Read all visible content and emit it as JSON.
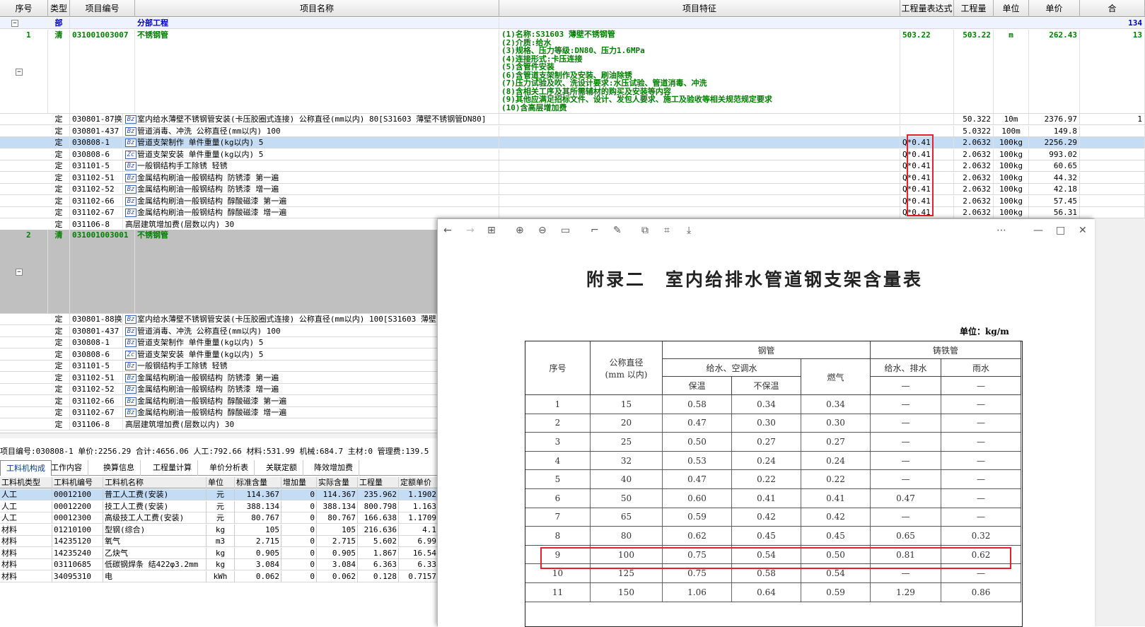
{
  "header": {
    "seq": "序号",
    "type": "类型",
    "code": "项目编号",
    "name": "项目名称",
    "feature": "项目特征",
    "expr": "工程量表达式",
    "qty": "工程量",
    "unit": "单位",
    "price": "单价",
    "total": "合"
  },
  "part_row": {
    "type": "部",
    "name": "分部工程",
    "total": "134"
  },
  "item1": {
    "seq": "1",
    "type": "清",
    "code": "031001003007",
    "name": "不锈钢管",
    "expr": "503.22",
    "qty": "503.22",
    "unit": "m",
    "price": "262.43",
    "total": "13",
    "features": [
      "(1)名称:S31603 薄壁不锈钢管",
      "(2)介质:给水",
      "(3)规格、压力等级:DN80、压力1.6MPa",
      "(4)连接形式:卡压连接",
      "(5)含管件安装",
      "(6)含管道支架制作及安装、刷油除锈",
      "(7)压力试验及吹、洗设计要求:水压试验、管道消毒、冲洗",
      "(8)含相关工序及其所需辅材的购买及安装等内容",
      "(9)其他应满足招标文件、设计、发包人要求、施工及验收等相关规范规定要求",
      "(10)含高层增加费"
    ]
  },
  "sub1": [
    {
      "type": "定",
      "code": "030801-87换",
      "tag": "Bz",
      "name": "室内给水薄壁不锈钢管安装(卡压胶圈式连接) 公称直径(mm以内) 80[S31603 薄壁不锈钢管DN80]",
      "expr": "",
      "qty": "50.322",
      "unit": "10m",
      "price": "2376.97",
      "total": "1"
    },
    {
      "type": "定",
      "code": "030801-437",
      "tag": "Bz",
      "name": "管道消毒、冲洗 公称直径(mm以内) 100",
      "expr": "",
      "qty": "5.0322",
      "unit": "100m",
      "price": "149.8",
      "total": ""
    },
    {
      "type": "定",
      "code": "030808-1",
      "tag": "Bz",
      "name": "管道支架制作 单件重量(kg以内) 5",
      "expr": "Q*0.41",
      "qty": "2.0632",
      "unit": "100kg",
      "price": "2256.29",
      "total": ""
    },
    {
      "type": "定",
      "code": "030808-6",
      "tag": "Zc",
      "name": "管道支架安装 单件重量(kg以内) 5",
      "expr": "Q*0.41",
      "qty": "2.0632",
      "unit": "100kg",
      "price": "993.02",
      "total": ""
    },
    {
      "type": "定",
      "code": "031101-5",
      "tag": "Bz",
      "name": "一般钢结构手工除锈 轻锈",
      "expr": "Q*0.41",
      "qty": "2.0632",
      "unit": "100kg",
      "price": "60.65",
      "total": ""
    },
    {
      "type": "定",
      "code": "031102-51",
      "tag": "Bz",
      "name": "金属结构刷油一般钢结构 防锈漆 第一遍",
      "expr": "Q*0.41",
      "qty": "2.0632",
      "unit": "100kg",
      "price": "44.32",
      "total": ""
    },
    {
      "type": "定",
      "code": "031102-52",
      "tag": "Bz",
      "name": "金属结构刷油一般钢结构 防锈漆 增一遍",
      "expr": "Q*0.41",
      "qty": "2.0632",
      "unit": "100kg",
      "price": "42.18",
      "total": ""
    },
    {
      "type": "定",
      "code": "031102-66",
      "tag": "Bz",
      "name": "金属结构刷油一般钢结构 醇酸磁漆 第一遍",
      "expr": "Q*0.41",
      "qty": "2.0632",
      "unit": "100kg",
      "price": "57.45",
      "total": ""
    },
    {
      "type": "定",
      "code": "031102-67",
      "tag": "Bz",
      "name": "金属结构刷油一般钢结构 醇酸磁漆 增一遍",
      "expr": "Q*0.41",
      "qty": "2.0632",
      "unit": "100kg",
      "price": "56.31",
      "total": ""
    },
    {
      "type": "定",
      "code": "031106-8",
      "tag": "",
      "name": "高层建筑增加费(层数以内) 30",
      "expr": "",
      "qty": "",
      "unit": "",
      "price": "",
      "total": ""
    }
  ],
  "item2": {
    "seq": "2",
    "type": "清",
    "code": "031001003001",
    "name": "不锈钢管"
  },
  "sub2": [
    {
      "type": "定",
      "code": "030801-88换",
      "tag": "Bz",
      "name": "室内给水薄壁不锈钢管安装(卡压胶圈式连接) 公称直径(mm以内) 100[S31603 薄壁"
    },
    {
      "type": "定",
      "code": "030801-437",
      "tag": "Bz",
      "name": "管道消毒、冲洗 公称直径(mm以内) 100"
    },
    {
      "type": "定",
      "code": "030808-1",
      "tag": "Bz",
      "name": "管道支架制作 单件重量(kg以内) 5"
    },
    {
      "type": "定",
      "code": "030808-6",
      "tag": "Zc",
      "name": "管道支架安装 单件重量(kg以内) 5"
    },
    {
      "type": "定",
      "code": "031101-5",
      "tag": "Bz",
      "name": "一般钢结构手工除锈 轻锈"
    },
    {
      "type": "定",
      "code": "031102-51",
      "tag": "Bz",
      "name": "金属结构刷油一般钢结构 防锈漆 第一遍"
    },
    {
      "type": "定",
      "code": "031102-52",
      "tag": "Bz",
      "name": "金属结构刷油一般钢结构 防锈漆 增一遍"
    },
    {
      "type": "定",
      "code": "031102-66",
      "tag": "Bz",
      "name": "金属结构刷油一般钢结构 醇酸磁漆 第一遍"
    },
    {
      "type": "定",
      "code": "031102-67",
      "tag": "Bz",
      "name": "金属结构刷油一般钢结构 醇酸磁漆 增一遍"
    },
    {
      "type": "定",
      "code": "031106-8",
      "tag": "",
      "name": "高层建筑增加费(层数以内) 30"
    }
  ],
  "info_bar": "项目编号:030808-1  单价:2256.29  合计:4656.06  人工:792.66  材料:531.99  机械:684.7  主材:0  管理费:139.5",
  "tabs": [
    "工料机构成",
    "工作内容",
    "换算信息",
    "工程量计算",
    "单价分析表",
    "关联定额",
    "降效增加费"
  ],
  "sub_header": [
    "工料机类型",
    "工料机编号",
    "工料机名称",
    "单位",
    "标准含量",
    "增加量",
    "实际含量",
    "工程量",
    "定额单价"
  ],
  "sub_rows": [
    [
      "人工",
      "00012100",
      "普工人工费(安装)",
      "元",
      "114.367",
      "0",
      "114.367",
      "235.962",
      "1.1902"
    ],
    [
      "人工",
      "00012200",
      "技工人工费(安装)",
      "元",
      "388.134",
      "0",
      "388.134",
      "800.798",
      "1.163"
    ],
    [
      "人工",
      "00012300",
      "高级技工人工费(安装)",
      "元",
      "80.767",
      "0",
      "80.767",
      "166.638",
      "1.1709"
    ],
    [
      "材料",
      "01210100",
      "型钢(综合)",
      "kg",
      "105",
      "0",
      "105",
      "216.636",
      "4.1"
    ],
    [
      "材料",
      "14235120",
      "氧气",
      "m3",
      "2.715",
      "0",
      "2.715",
      "5.602",
      "6.99"
    ],
    [
      "材料",
      "14235240",
      "乙炔气",
      "kg",
      "0.905",
      "0",
      "0.905",
      "1.867",
      "16.54"
    ],
    [
      "材料",
      "03110685",
      "低碳钢焊条 结422φ3.2mm",
      "kg",
      "3.084",
      "0",
      "3.084",
      "6.363",
      "6.33"
    ],
    [
      "材料",
      "34095310",
      "电",
      "kWh",
      "0.062",
      "0",
      "0.062",
      "0.128",
      "0.7157"
    ]
  ],
  "viewer": {
    "title": "附录二　室内给排水管道钢支架含量表",
    "unit": "单位：kg/m",
    "table_header": {
      "seq": "序号",
      "dn": "公称直径",
      "dn2": "(mm 以内)",
      "steel": "钢管",
      "water_air": "给水、空调水",
      "insul": "保温",
      "no_insul": "不保温",
      "gas": "燃气",
      "iron": "铸铁管",
      "water_drain": "给水、排水",
      "rain": "雨水"
    },
    "rows": [
      [
        "1",
        "15",
        "0.58",
        "0.34",
        "0.34",
        "—",
        "—"
      ],
      [
        "2",
        "20",
        "0.47",
        "0.30",
        "0.30",
        "—",
        "—"
      ],
      [
        "3",
        "25",
        "0.50",
        "0.27",
        "0.27",
        "—",
        "—"
      ],
      [
        "4",
        "32",
        "0.53",
        "0.24",
        "0.24",
        "—",
        "—"
      ],
      [
        "5",
        "40",
        "0.47",
        "0.22",
        "0.22",
        "—",
        "—"
      ],
      [
        "6",
        "50",
        "0.60",
        "0.41",
        "0.41",
        "0.47",
        "—"
      ],
      [
        "7",
        "65",
        "0.59",
        "0.42",
        "0.42",
        "—",
        "—"
      ],
      [
        "8",
        "80",
        "0.62",
        "0.45",
        "0.45",
        "0.65",
        "0.32"
      ],
      [
        "9",
        "100",
        "0.75",
        "0.54",
        "0.50",
        "0.81",
        "0.62"
      ],
      [
        "10",
        "125",
        "0.75",
        "0.58",
        "0.54",
        "—",
        "—"
      ],
      [
        "11",
        "150",
        "1.06",
        "0.64",
        "0.59",
        "1.29",
        "0.86"
      ]
    ],
    "dash": "—"
  },
  "colors": {
    "green": "#008000",
    "blue": "#0000cc",
    "red": "#e8202a",
    "select": "#c5dcf5"
  }
}
